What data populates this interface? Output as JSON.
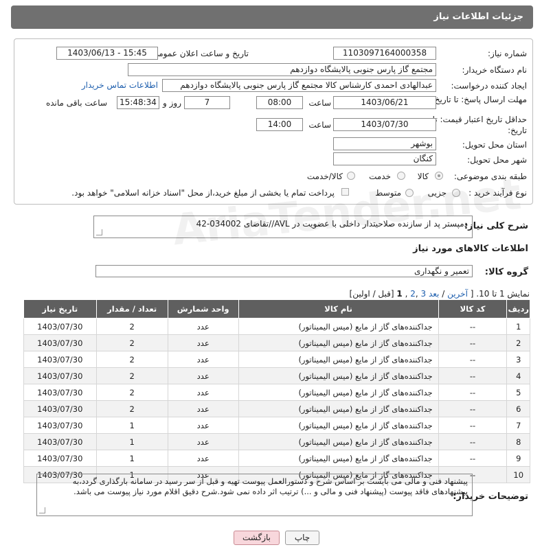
{
  "header": {
    "title": "جزئیات اطلاعات نیاز"
  },
  "form": {
    "need_number_label": "شماره نیاز:",
    "need_number": "1103097164000358",
    "announce_label": "تاریخ و ساعت اعلان عمومی:",
    "announce_value": "1403/06/13 - 15:45",
    "buyer_org_label": "نام دستگاه خریدار:",
    "buyer_org": "مجتمع گاز پارس جنوبی  پالایشگاه دوازدهم",
    "requester_label": "ایجاد کننده درخواست:",
    "requester": "عبدالهادی احمدی کارشناس کالا مجتمع گاز پارس جنوبی  پالایشگاه دوازدهم",
    "contact_link": "اطلاعات تماس خریدار",
    "deadline_label": "مهلت ارسال پاسخ: تا تاریخ:",
    "deadline_date": "1403/06/21",
    "time_label": "ساعت",
    "deadline_time": "08:00",
    "days_value": "7",
    "days_label": "روز و",
    "remaining_time": "15:48:34",
    "remaining_label": "ساعت باقی مانده",
    "validity_label": "حداقل تاریخ اعتبار قیمت: تا تاریخ:",
    "validity_date": "1403/07/30",
    "validity_time": "14:00",
    "province_label": "استان محل تحویل:",
    "province": "بوشهر",
    "city_label": "شهر محل تحویل:",
    "city": "کنگان",
    "category_label": "طبقه بندی موضوعی:",
    "category_options": [
      "کالا",
      "خدمت",
      "کالا/خدمت"
    ],
    "process_label": "نوع فرآیند خرید :",
    "process_options": [
      "جزیی",
      "متوسط"
    ],
    "payment_note": "پرداخت تمام یا بخشی از مبلغ خرید،از محل \"اسناد خزانه اسلامی\" خواهد بود."
  },
  "description": {
    "label": "شرح کلی نیاز:",
    "value": "دمپستر پد از سازنده صلاحیتدار داخلی با عضویت در AVL//تقاضای 034002-42"
  },
  "goods_section": {
    "title": "اطلاعات کالاهای مورد نیاز"
  },
  "goods_group": {
    "label": "گروه کالا:",
    "value": "تعمیر و نگهداری"
  },
  "pagination": {
    "prefix": "نمایش 1 تا 10. [",
    "last": "آخرین",
    "next": "بعد",
    "page3": "3",
    "page2": "2",
    "page1": "1",
    "tail": "[قبل / اولین]"
  },
  "table": {
    "headers": [
      "ردیف",
      "کد کالا",
      "نام کالا",
      "واحد شمارش",
      "تعداد / مقدار",
      "تاریخ نیاز"
    ],
    "rows": [
      [
        "1",
        "--",
        "جداکننده‌های گاز از مایع (میس الیمیناتور)",
        "عدد",
        "2",
        "1403/07/30"
      ],
      [
        "2",
        "--",
        "جداکننده‌های گاز از مایع (میس الیمیناتور)",
        "عدد",
        "2",
        "1403/07/30"
      ],
      [
        "3",
        "--",
        "جداکننده‌های گاز از مایع (میس الیمیناتور)",
        "عدد",
        "2",
        "1403/07/30"
      ],
      [
        "4",
        "--",
        "جداکننده‌های گاز از مایع (میس الیمیناتور)",
        "عدد",
        "2",
        "1403/07/30"
      ],
      [
        "5",
        "--",
        "جداکننده‌های گاز از مایع (میس الیمیناتور)",
        "عدد",
        "2",
        "1403/07/30"
      ],
      [
        "6",
        "--",
        "جداکننده‌های گاز از مایع (میس الیمیناتور)",
        "عدد",
        "2",
        "1403/07/30"
      ],
      [
        "7",
        "--",
        "جداکننده‌های گاز از مایع (میس الیمیناتور)",
        "عدد",
        "1",
        "1403/07/30"
      ],
      [
        "8",
        "--",
        "جداکننده‌های گاز از مایع (میس الیمیناتور)",
        "عدد",
        "1",
        "1403/07/30"
      ],
      [
        "9",
        "--",
        "جداکننده‌های گاز از مایع (میس الیمیناتور)",
        "عدد",
        "1",
        "1403/07/30"
      ],
      [
        "10",
        "--",
        "جداکننده‌های گاز از مایع (میس الیمیناتور)",
        "عدد",
        "1",
        "1403/07/30"
      ]
    ]
  },
  "buyer_notes": {
    "label": "توضیحات خریدار:",
    "value": "پیشنهاد فنی و مالی می بایست بر اساس شرح و دستورالعمل پیوست تهیه و قبل از سر رسید در سامانه بارگذاری گردد،به پیشنهادهای فاقد پیوست (پیشنهاد فنی و مالی و ...) ترتیب اثر داده نمی شود.شرح دقیق اقلام مورد نیاز پیوست می باشد."
  },
  "buttons": {
    "print": "چاپ",
    "back": "بازگشت"
  },
  "watermark": "AriaTender.net",
  "colors": {
    "header_bg": "#707070",
    "table_header_bg": "#5f5f5f",
    "link": "#1e5fae",
    "back_button_bg": "#f8d7dc"
  }
}
